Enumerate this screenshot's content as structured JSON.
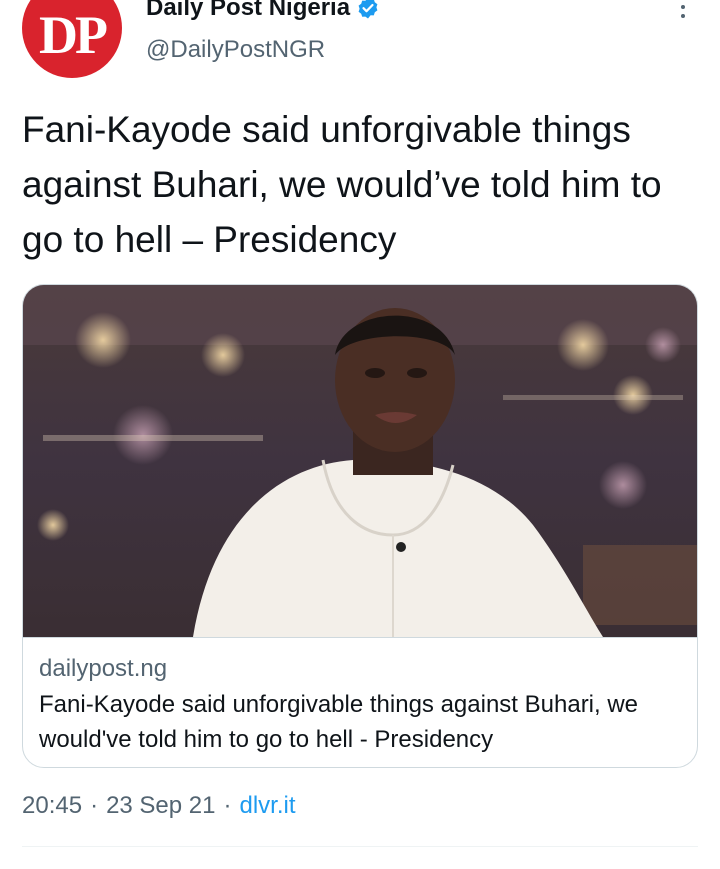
{
  "author": {
    "name": "Daily Post Nigeria",
    "handle": "@DailyPostNGR",
    "avatar_text": "DP",
    "verified": true,
    "avatar_color": "#d9232d"
  },
  "tweet": {
    "text": "Fani-Kayode said unforgivable things against Buhari, we would’ve told him to go to hell – Presidency"
  },
  "card": {
    "image_icon": "photo-of-man-speaking",
    "domain": "dailypost.ng",
    "title": "Fani-Kayode said unforgivable things against Buhari, we would've told him to go to hell - Presidency"
  },
  "meta": {
    "time": "20:45",
    "separator": "·",
    "date": "23 Sep 21",
    "source": "dlvr.it"
  },
  "colors": {
    "verified_blue": "#1d9bf0",
    "secondary_text": "#536471",
    "border": "#cfd9de"
  }
}
